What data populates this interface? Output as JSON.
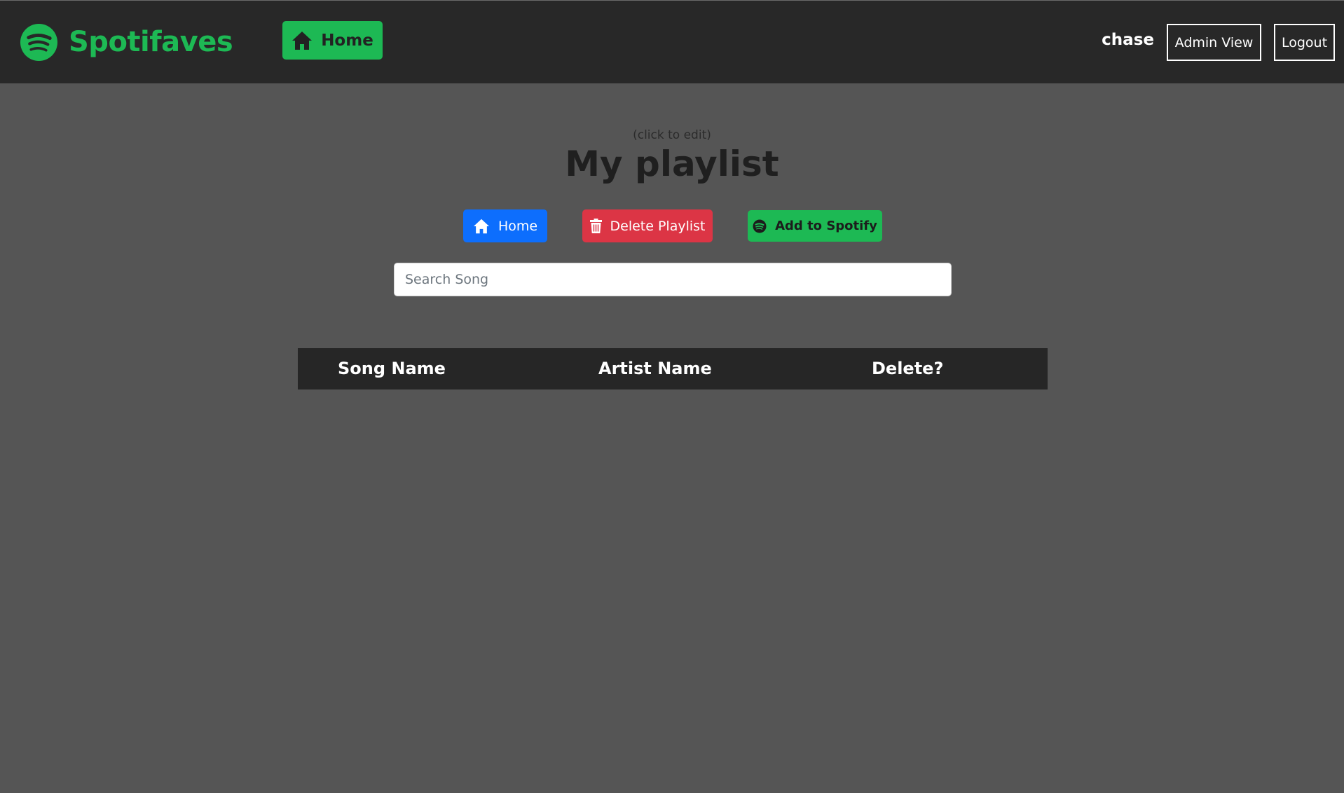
{
  "navbar": {
    "brand_name": "Spotifaves",
    "home_label": "Home",
    "username": "chase",
    "admin_label": "Admin View",
    "logout_label": "Logout"
  },
  "playlist": {
    "edit_hint": "(click to edit)",
    "title": "My playlist"
  },
  "actions": {
    "home_label": "Home",
    "delete_label": "Delete Playlist",
    "spotify_label": "Add to Spotify"
  },
  "search": {
    "placeholder": "Search Song",
    "value": ""
  },
  "table": {
    "columns": [
      "Song Name",
      "Artist Name",
      "Delete?"
    ],
    "rows": []
  },
  "icons": {
    "brand": "spotify-logo-icon",
    "nav_home": "house-icon",
    "home": "house-icon",
    "delete": "trash-icon",
    "spotify": "spotify-icon"
  },
  "colors": {
    "brand_green": "#1db954",
    "navbar_bg": "#282828",
    "page_bg": "#555555",
    "primary_blue": "#0d6efd",
    "danger_red": "#dc3545",
    "table_header_bg": "#262626"
  }
}
